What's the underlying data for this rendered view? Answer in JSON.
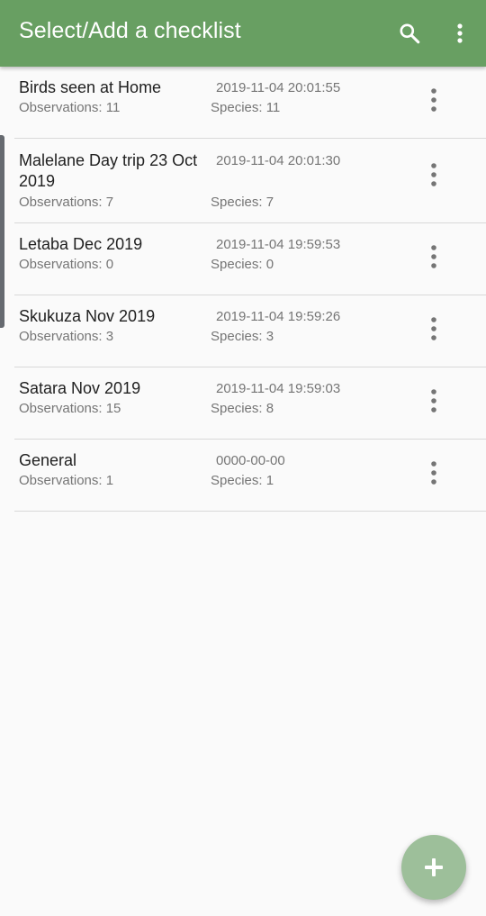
{
  "appbar": {
    "title": "Select/Add a checklist",
    "background_color": "#689f62",
    "actions": [
      "search-icon",
      "more-vert-icon"
    ]
  },
  "checklists": [
    {
      "name": "Birds seen at Home",
      "date": "2019-11-04 20:01:55",
      "observations": "Observations: 11",
      "species": "Species: 11"
    },
    {
      "name": "Malelane Day trip 23 Oct 2019",
      "date": "2019-11-04 20:01:30",
      "observations": "Observations: 7",
      "species": "Species: 7"
    },
    {
      "name": "Letaba Dec 2019",
      "date": "2019-11-04 19:59:53",
      "observations": "Observations: 0",
      "species": "Species: 0"
    },
    {
      "name": "Skukuza Nov 2019",
      "date": "2019-11-04 19:59:26",
      "observations": "Observations: 3",
      "species": "Species: 3"
    },
    {
      "name": "Satara Nov 2019",
      "date": "2019-11-04 19:59:03",
      "observations": "Observations: 15",
      "species": "Species: 8"
    },
    {
      "name": "General",
      "date": "0000-00-00",
      "observations": "Observations: 1",
      "species": "Species: 1"
    }
  ],
  "fab": {
    "icon": "plus-icon",
    "color": "#9dbf9a"
  }
}
